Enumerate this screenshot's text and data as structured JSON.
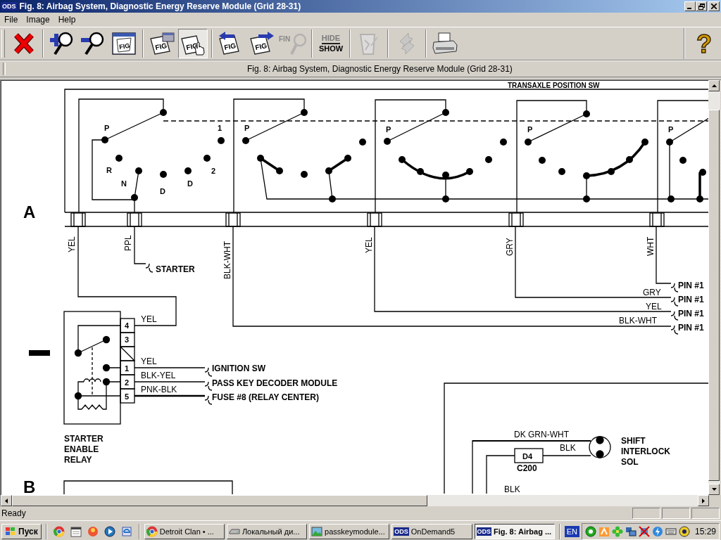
{
  "window": {
    "app_icon_text": "ODS",
    "title": "Fig. 8: Airbag System, Diagnostic Energy Reserve Module (Grid 28-31)",
    "controls": [
      {
        "kind": "minimize"
      },
      {
        "kind": "restore"
      },
      {
        "kind": "close"
      }
    ]
  },
  "menu": [
    "File",
    "Image",
    "Help"
  ],
  "toolbar": {
    "groups": [
      [
        {
          "kind": "close",
          "disabled": false,
          "pressed": false
        }
      ],
      [
        {
          "kind": "zoom-in",
          "disabled": false,
          "pressed": false
        },
        {
          "kind": "zoom-out",
          "disabled": false,
          "pressed": false
        },
        {
          "kind": "figure-window",
          "icon_text": "FIG",
          "disabled": false,
          "pressed": false
        }
      ],
      [
        {
          "kind": "figure-popup",
          "icon_text": "FIG",
          "disabled": false,
          "pressed": false
        },
        {
          "kind": "figure-hand",
          "icon_text": "FIG",
          "disabled": false,
          "pressed": true
        }
      ],
      [
        {
          "kind": "figure-prev",
          "icon_text": "FIG",
          "disabled": false,
          "pressed": false
        },
        {
          "kind": "figure-next",
          "icon_text": "FIG",
          "disabled": false,
          "pressed": false
        },
        {
          "kind": "find",
          "icon_text": "FIN",
          "disabled": true,
          "pressed": false
        }
      ],
      [
        {
          "kind": "hide-show",
          "label_lines": [
            "HIDE",
            "SHOW"
          ],
          "disabled": false,
          "pressed": false
        }
      ],
      [
        {
          "kind": "clipboard",
          "disabled": true,
          "pressed": false
        }
      ],
      [
        {
          "kind": "refresh",
          "disabled": true,
          "pressed": false
        }
      ],
      [
        {
          "kind": "print",
          "disabled": false,
          "pressed": false
        }
      ]
    ],
    "help": {
      "icon_text": "?"
    }
  },
  "caption": "Fig. 8: Airbag System, Diagnostic Energy Reserve Module (Grid 28-31)",
  "diagram": {
    "section_labels": [
      "A",
      "B"
    ],
    "labels": [
      {
        "text": "TRANSAXLE POSITION SW",
        "kind": "component"
      },
      {
        "text": "P",
        "kind": "position"
      },
      {
        "text": "1",
        "kind": "position"
      },
      {
        "text": "R",
        "kind": "position"
      },
      {
        "text": "N",
        "kind": "position"
      },
      {
        "text": "D",
        "kind": "position"
      },
      {
        "text": "D",
        "kind": "position"
      },
      {
        "text": "2",
        "kind": "position"
      },
      {
        "text": "P",
        "kind": "position"
      },
      {
        "text": "P",
        "kind": "position"
      },
      {
        "text": "P",
        "kind": "position"
      },
      {
        "text": "P",
        "kind": "position"
      },
      {
        "text": "YEL",
        "kind": "wire"
      },
      {
        "text": "PPL",
        "kind": "wire"
      },
      {
        "text": "STARTER",
        "kind": "component"
      },
      {
        "text": "BLK-WHT",
        "kind": "wire"
      },
      {
        "text": "YEL",
        "kind": "wire"
      },
      {
        "text": "GRY",
        "kind": "wire"
      },
      {
        "text": "WHT",
        "kind": "wire"
      },
      {
        "text": "PIN #1",
        "kind": "component"
      },
      {
        "text": "PIN #1",
        "kind": "component"
      },
      {
        "text": "PIN #1",
        "kind": "component"
      },
      {
        "text": "PIN #1",
        "kind": "component"
      },
      {
        "text": "GRY",
        "kind": "wire"
      },
      {
        "text": "YEL",
        "kind": "wire"
      },
      {
        "text": "BLK-WHT",
        "kind": "wire"
      },
      {
        "text": "4",
        "kind": "pin"
      },
      {
        "text": "3",
        "kind": "pin"
      },
      {
        "text": "1",
        "kind": "pin"
      },
      {
        "text": "2",
        "kind": "pin"
      },
      {
        "text": "5",
        "kind": "pin"
      },
      {
        "text": "YEL",
        "kind": "wire"
      },
      {
        "text": "YEL",
        "kind": "wire"
      },
      {
        "text": "BLK-YEL",
        "kind": "wire"
      },
      {
        "text": "PNK-BLK",
        "kind": "wire"
      },
      {
        "text": "IGNITION SW",
        "kind": "component"
      },
      {
        "text": "PASS KEY DECODER MODULE",
        "kind": "component"
      },
      {
        "text": "FUSE #8 (RELAY CENTER)",
        "kind": "component"
      },
      {
        "text": "STARTER",
        "kind": "component"
      },
      {
        "text": "ENABLE",
        "kind": "component"
      },
      {
        "text": "RELAY",
        "kind": "component"
      },
      {
        "text": "DK GRN-WHT",
        "kind": "wire"
      },
      {
        "text": "BLK",
        "kind": "wire"
      },
      {
        "text": "D4",
        "kind": "pin"
      },
      {
        "text": "C200",
        "kind": "component"
      },
      {
        "text": "SHIFT",
        "kind": "component"
      },
      {
        "text": "INTERLOCK",
        "kind": "component"
      },
      {
        "text": "SOL",
        "kind": "component"
      },
      {
        "text": "BLK",
        "kind": "wire"
      }
    ]
  },
  "status_bar": {
    "text": "Ready"
  },
  "taskbar": {
    "start": "Пуск",
    "quick_launch": [
      {
        "kind": "chrome"
      },
      {
        "kind": "calendar"
      },
      {
        "kind": "media"
      },
      {
        "kind": "player"
      },
      {
        "kind": "ie"
      }
    ],
    "tasks": [
      {
        "kind": "chrome",
        "label": "Detroit Clan • ...",
        "selected": false
      },
      {
        "kind": "drive",
        "label": "Локальный ди...",
        "selected": false
      },
      {
        "kind": "image",
        "label": "passkeymodule...",
        "selected": false
      },
      {
        "kind": "ods",
        "icon_text": "ODS",
        "label": "OnDemand5",
        "selected": false
      },
      {
        "kind": "ods",
        "icon_text": "ODS",
        "label": "Fig. 8: Airbag ...",
        "selected": true
      }
    ],
    "language": "EN",
    "tray": [
      {
        "kind": "green"
      },
      {
        "kind": "orange"
      },
      {
        "kind": "flower"
      },
      {
        "kind": "network"
      },
      {
        "kind": "muted"
      },
      {
        "kind": "power"
      },
      {
        "kind": "keyboard"
      },
      {
        "kind": "wireless"
      }
    ],
    "clock": "15:29"
  }
}
